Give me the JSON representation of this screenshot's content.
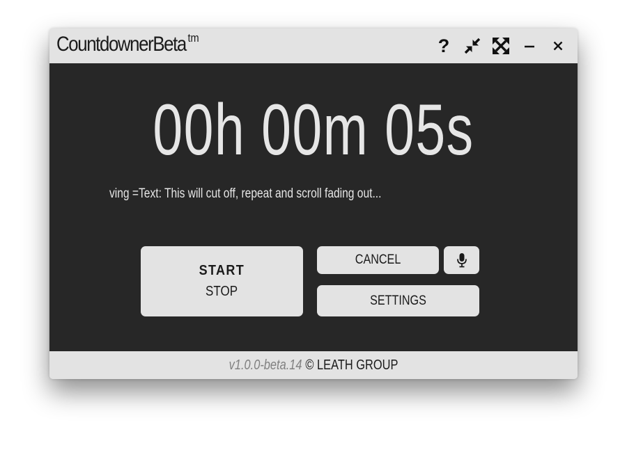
{
  "window": {
    "title": "CountdownerBeta",
    "title_sup": "tm",
    "controls": {
      "help_label": "?",
      "help_icon": "help-icon",
      "compact_icon": "compress-arrows-icon",
      "fullscreen_icon": "expand-arrows-icon",
      "minimize_icon": "minimize-icon",
      "close_icon": "close-icon"
    }
  },
  "timer": {
    "display": "00h 00m 05s"
  },
  "marquee": {
    "text": "ving =Text: This will cut off, repeat and scroll fading out..."
  },
  "buttons": {
    "start_label": "START",
    "stop_label": "STOP",
    "cancel_label": "CANCEL",
    "mic_icon": "microphone-icon",
    "settings_label": "SETTINGS"
  },
  "footer": {
    "version": "v1.0.0-beta.14",
    "copyright": "© LEATH GROUP"
  },
  "colors": {
    "main_background": "#272727",
    "chrome_background": "#e3e3e3",
    "timer_text": "#e6e6e6",
    "version_text": "#808080"
  }
}
